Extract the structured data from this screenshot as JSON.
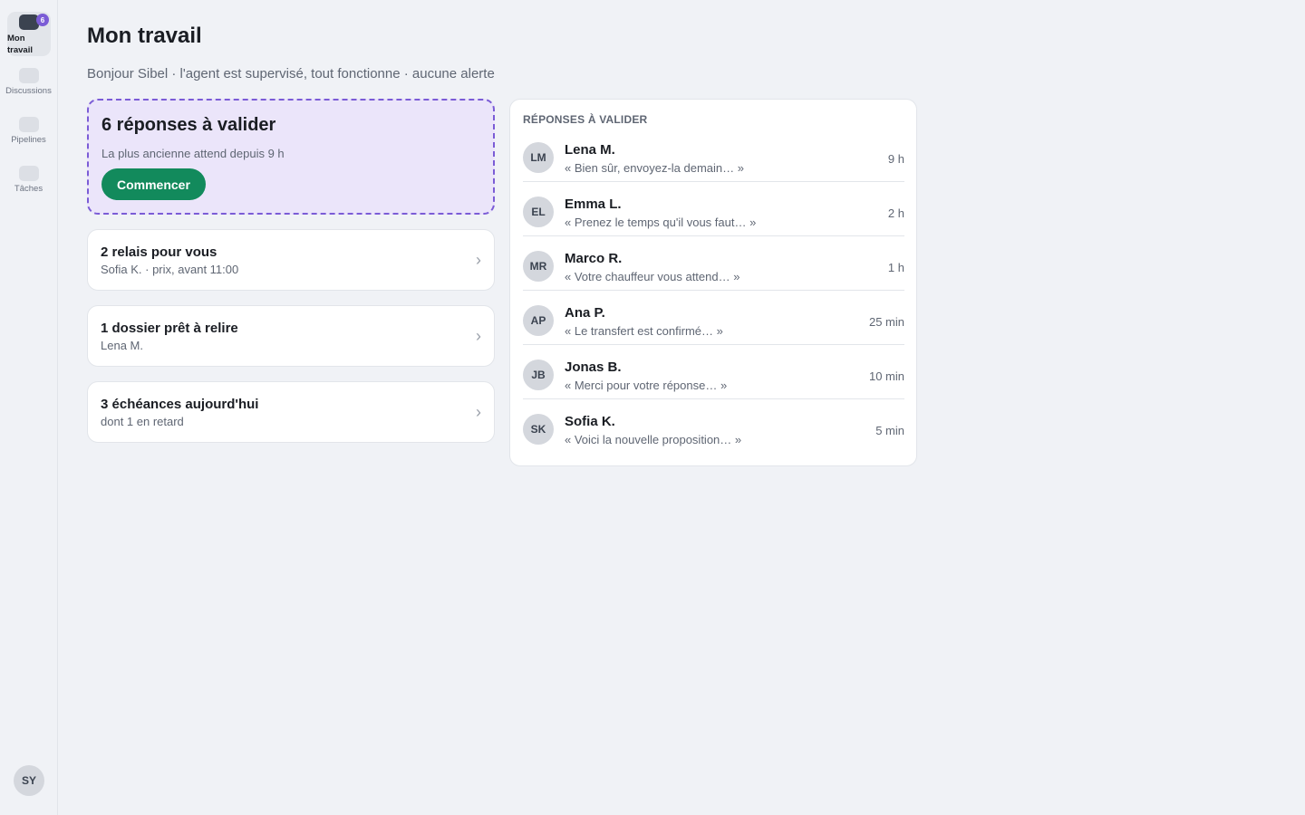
{
  "sidebar": {
    "items": [
      {
        "label": "Mon travail",
        "icon": "work-icon",
        "badge": "6",
        "active": true
      },
      {
        "label": "Discussions",
        "icon": "chat-icon"
      },
      {
        "label": "Pipelines",
        "icon": "pipeline-icon"
      },
      {
        "label": "Tâches",
        "icon": "tasks-icon"
      }
    ],
    "user_initials": "SY"
  },
  "header": {
    "title": "Mon travail",
    "greeting": "Bonjour Sibel · l'agent est supervisé, tout fonctionne · aucune alerte"
  },
  "validate_card": {
    "title": "6 réponses à valider",
    "subtitle": "La plus ancienne attend depuis 9 h",
    "button_label": "Commencer"
  },
  "summary_cards": [
    {
      "title": "2 relais pour vous",
      "subtitle": "Sofia K. · prix, avant 11:00"
    },
    {
      "title": "1 dossier prêt à relire",
      "subtitle": "Lena M."
    },
    {
      "title": "3 échéances aujourd'hui",
      "subtitle": "dont 1 en retard"
    }
  ],
  "replies": {
    "heading": "RÉPONSES À VALIDER",
    "items": [
      {
        "initials": "LM",
        "name": "Lena M.",
        "snippet": "« Bien sûr, envoyez-la demain… »",
        "time": "9 h"
      },
      {
        "initials": "EL",
        "name": "Emma L.",
        "snippet": "« Prenez le temps qu'il vous faut… »",
        "time": "2 h"
      },
      {
        "initials": "MR",
        "name": "Marco R.",
        "snippet": "« Votre chauffeur vous attend… »",
        "time": "1 h"
      },
      {
        "initials": "AP",
        "name": "Ana P.",
        "snippet": "« Le transfert est confirmé… »",
        "time": "25 min"
      },
      {
        "initials": "JB",
        "name": "Jonas B.",
        "snippet": "« Merci pour votre réponse… »",
        "time": "10 min"
      },
      {
        "initials": "SK",
        "name": "Sofia K.",
        "snippet": "« Voici la nouvelle proposition… »",
        "time": "5 min"
      }
    ]
  },
  "colors": {
    "accent": "#7b5cd6",
    "primary_button": "#128a5c",
    "validate_bg": "#ebe5fa"
  }
}
